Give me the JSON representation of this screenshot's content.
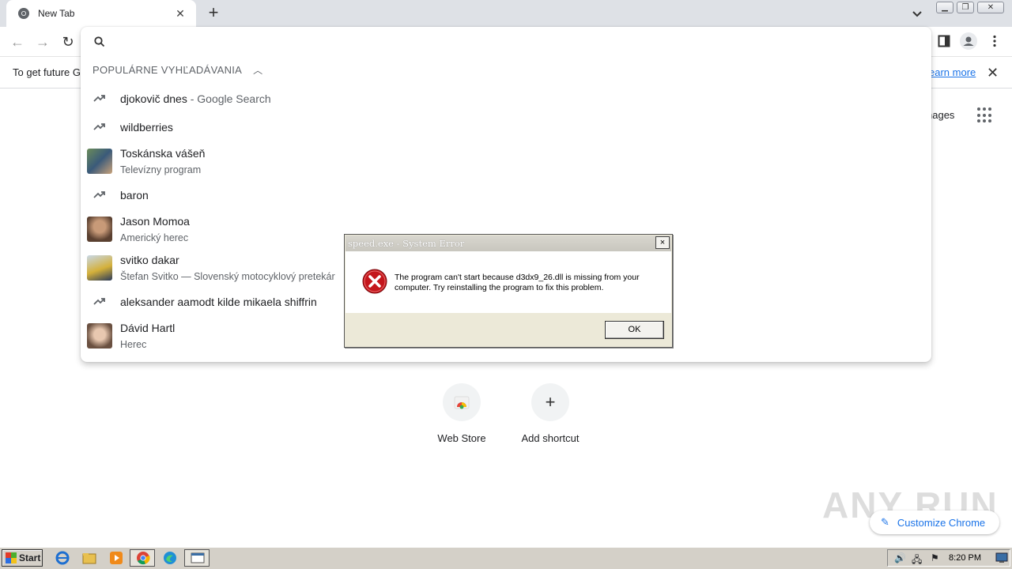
{
  "tab": {
    "title": "New Tab"
  },
  "infobar": {
    "text": "To get future G",
    "learn_more": "earn more"
  },
  "ntp": {
    "images_link": "nages",
    "tiles": [
      {
        "label": "Web Store"
      },
      {
        "label": "Add shortcut"
      }
    ],
    "customize": "Customize Chrome",
    "watermark": "ANY RUN"
  },
  "dropdown": {
    "section_header": "POPULÁRNE VYHĽADÁVANIA",
    "suggestions": [
      {
        "kind": "trend",
        "text": "djokovič dnes",
        "suffix": " - Google Search"
      },
      {
        "kind": "trend",
        "text": "wildberries"
      },
      {
        "kind": "entity",
        "text": "Toskánska vášeň",
        "sub": "Televízny program"
      },
      {
        "kind": "trend",
        "text": "baron"
      },
      {
        "kind": "entity",
        "text": "Jason Momoa",
        "sub": "Americký herec"
      },
      {
        "kind": "entity",
        "text": "svitko dakar",
        "sub": "Štefan Svitko — Slovenský motocyklový pretekár"
      },
      {
        "kind": "trend",
        "text": "aleksander aamodt kilde mikaela shiffrin"
      },
      {
        "kind": "entity",
        "text": "Dávid Hartl",
        "sub": "Herec"
      }
    ]
  },
  "dialog": {
    "title": "speed.exe - System Error",
    "close": "×",
    "message": "The program can't start because d3dx9_26.dll is missing from your computer. Try reinstalling the program to fix this problem.",
    "ok": "OK"
  },
  "taskbar": {
    "start": "Start",
    "clock": "8:20 PM"
  },
  "colors": {
    "accent": "#1a73e8",
    "tabstrip": "#dee1e6",
    "dialog_face": "#ece9d8",
    "error_red": "#c4161c"
  }
}
